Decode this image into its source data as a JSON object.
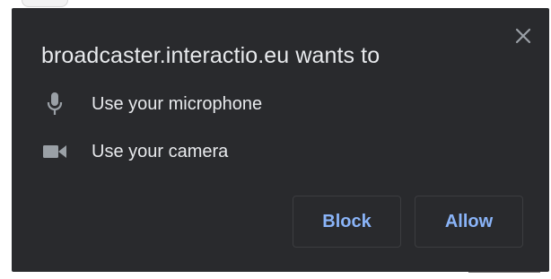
{
  "prompt": {
    "origin_title": "broadcaster.interactio.eu wants to",
    "permissions": [
      {
        "icon": "microphone-icon",
        "label": "Use your microphone"
      },
      {
        "icon": "camera-icon",
        "label": "Use your camera"
      }
    ],
    "buttons": {
      "block_label": "Block",
      "allow_label": "Allow"
    },
    "close_icon": "close-icon"
  },
  "colors": {
    "dialog_bg": "#292a2d",
    "text": "#e8eaed",
    "icon": "#9aa0a6",
    "accent": "#8ab4f8",
    "button_border": "#3c3d40"
  }
}
